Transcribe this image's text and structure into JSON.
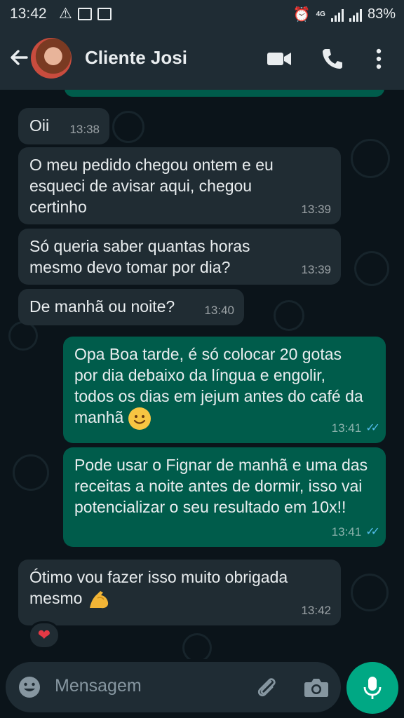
{
  "status_bar": {
    "time": "13:42",
    "network": "4G",
    "battery": "83%",
    "left_icons": [
      "alert-icon",
      "voicemail-icon",
      "gallery-icon"
    ],
    "right_icons": [
      "alarm-icon",
      "signal-icon",
      "signal-icon",
      "battery"
    ]
  },
  "header": {
    "contact_name": "Cliente Josi",
    "icons": [
      "back-arrow-icon",
      "video-call-icon",
      "voice-call-icon",
      "more-options-icon"
    ]
  },
  "messages": [
    {
      "dir": "in",
      "text": "Oii",
      "time": "13:38"
    },
    {
      "dir": "in",
      "text": "O meu pedido chegou ontem e eu esqueci de avisar aqui, chegou certinho",
      "time": "13:39"
    },
    {
      "dir": "in",
      "text": "Só queria saber quantas horas mesmo devo tomar por dia?",
      "time": "13:39"
    },
    {
      "dir": "in",
      "text": "De manhã ou noite?",
      "time": "13:40"
    },
    {
      "dir": "out",
      "text": "Opa Boa tarde, é só colocar 20 gotas por dia debaixo da língua e engolir, todos os dias em jejum antes do café da manhã",
      "emoji": "smiling-face-emoji",
      "time": "13:41",
      "status": "read"
    },
    {
      "dir": "out",
      "text": "Pode usar o Fignar de manhã e uma das receitas a noite antes de dormir, isso vai potencializar o seu resultado em 10x!!",
      "time": "13:41",
      "status": "read"
    },
    {
      "dir": "in",
      "text": "Ótimo vou fazer isso muito obrigada mesmo",
      "emoji": "flexed-biceps-emoji",
      "time": "13:42",
      "reaction": "❤"
    }
  ],
  "input": {
    "placeholder": "Mensagem",
    "icons": [
      "emoji-icon",
      "attach-icon",
      "camera-icon",
      "mic-icon"
    ]
  },
  "colors": {
    "header_bg": "#1f2c34",
    "chat_bg": "#0b141a",
    "incoming_bubble": "#202c33",
    "outgoing_bubble": "#005c4b",
    "read_ticks": "#53bdeb",
    "accent": "#00a884"
  }
}
